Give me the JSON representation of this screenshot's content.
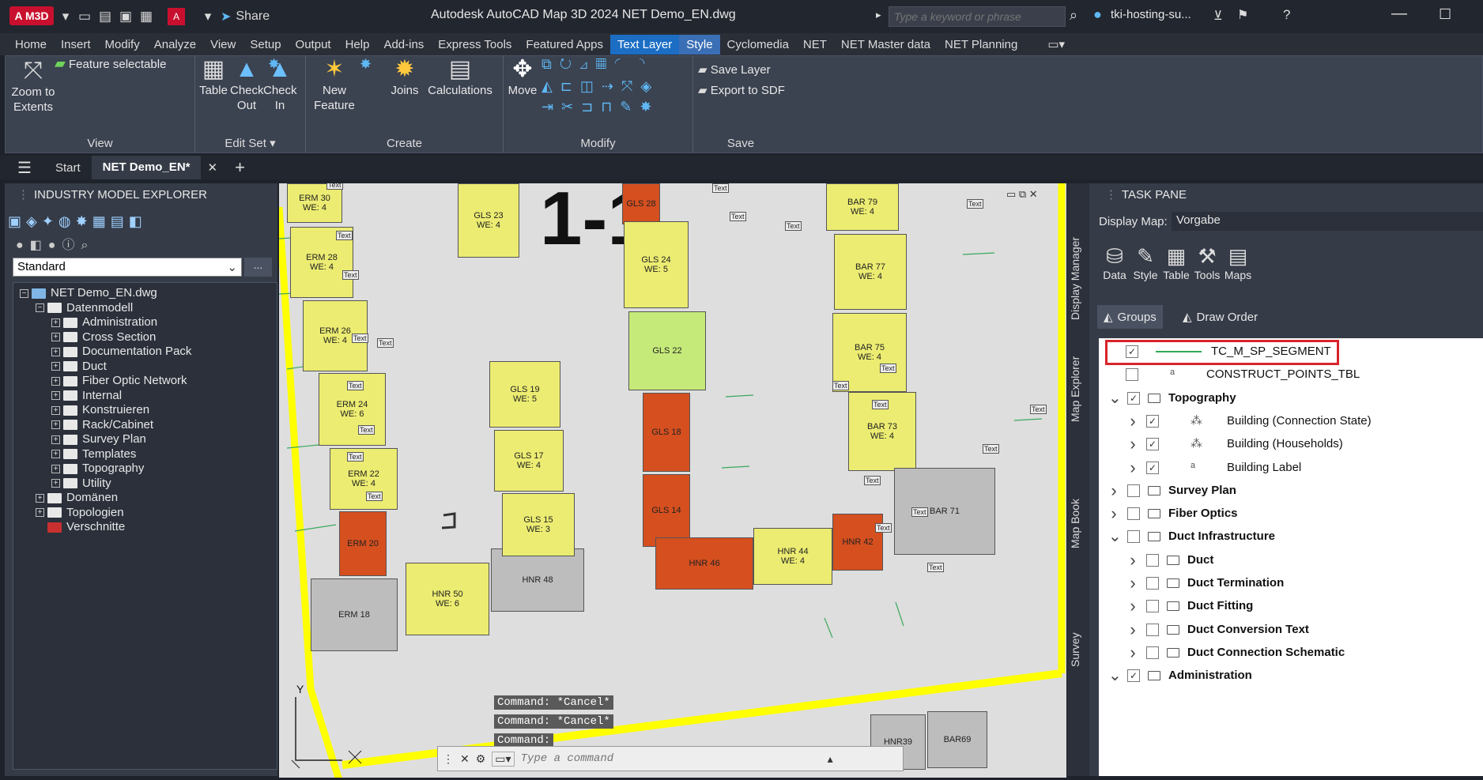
{
  "titlebar": {
    "badge": "A M3D",
    "share": "Share",
    "title": "Autodesk AutoCAD Map 3D 2024    NET Demo_EN.dwg",
    "search_placeholder": "Type a keyword or phrase",
    "user": "tki-hosting-su..."
  },
  "menu": [
    "Home",
    "Insert",
    "Modify",
    "Analyze",
    "View",
    "Setup",
    "Output",
    "Help",
    "Add-ins",
    "Express Tools",
    "Featured Apps",
    "Text Layer",
    "Style",
    "Cyclomedia",
    "NET",
    "NET Master data",
    "NET Planning"
  ],
  "ribbon": {
    "zoom_extents": "Zoom to Extents",
    "feature_selectable": "Feature selectable",
    "view_label": "View",
    "table": "Table",
    "check_out": "Check Out",
    "check_in": "Check In",
    "edit_set_label": "Edit Set",
    "new_feature": "New Feature",
    "joins": "Joins",
    "calculations": "Calculations",
    "create_label": "Create",
    "move": "Move",
    "modify_label": "Modify",
    "save_layer": "Save Layer",
    "export_sdf": "Export to SDF",
    "save_label": "Save"
  },
  "tabs": {
    "start": "Start",
    "doc": "NET Demo_EN*",
    "add": "+"
  },
  "left": {
    "header": "INDUSTRY MODEL EXPLORER",
    "combo_value": "Standard",
    "combo_more": "...",
    "tree": [
      {
        "label": "NET Demo_EN.dwg",
        "level": 0,
        "pm": "−"
      },
      {
        "label": "Datenmodell",
        "level": 1,
        "pm": "−"
      },
      {
        "label": "Administration",
        "level": 2,
        "pm": "+"
      },
      {
        "label": "Cross Section",
        "level": 2,
        "pm": "+"
      },
      {
        "label": "Documentation Pack",
        "level": 2,
        "pm": "+"
      },
      {
        "label": "Duct",
        "level": 2,
        "pm": "+"
      },
      {
        "label": "Fiber Optic Network",
        "level": 2,
        "pm": "+"
      },
      {
        "label": "Internal",
        "level": 2,
        "pm": "+"
      },
      {
        "label": "Konstruieren",
        "level": 2,
        "pm": "+"
      },
      {
        "label": "Rack/Cabinet",
        "level": 2,
        "pm": "+"
      },
      {
        "label": "Survey Plan",
        "level": 2,
        "pm": "+"
      },
      {
        "label": "Templates",
        "level": 2,
        "pm": "+"
      },
      {
        "label": "Topography",
        "level": 2,
        "pm": "+"
      },
      {
        "label": "Utility",
        "level": 2,
        "pm": "+"
      },
      {
        "label": "Domänen",
        "level": 1,
        "pm": "+"
      },
      {
        "label": "Topologien",
        "level": 1,
        "pm": "+"
      },
      {
        "label": "Verschnitte",
        "level": 1,
        "pm": ""
      }
    ]
  },
  "map": {
    "big_label": "1-1",
    "buildings": [
      {
        "name": "ERM 30",
        "sub": "WE: 4",
        "cls": "yel"
      },
      {
        "name": "ERM 28",
        "sub": "WE: 4",
        "cls": "yel"
      },
      {
        "name": "ERM 26",
        "sub": "WE: 4",
        "cls": "yel"
      },
      {
        "name": "ERM 24",
        "sub": "WE: 6",
        "cls": "yel"
      },
      {
        "name": "ERM 22",
        "sub": "WE: 4",
        "cls": "yel"
      },
      {
        "name": "ERM 20",
        "sub": "",
        "cls": "red"
      },
      {
        "name": "ERM 18",
        "sub": "",
        "cls": "gry"
      },
      {
        "name": "HNR 50",
        "sub": "WE: 6",
        "cls": "yel"
      },
      {
        "name": "HNR 48",
        "sub": "",
        "cls": "gry"
      },
      {
        "name": "GLS 23",
        "sub": "WE: 4",
        "cls": "yel"
      },
      {
        "name": "GLS 19",
        "sub": "WE: 5",
        "cls": "yel"
      },
      {
        "name": "GLS 17",
        "sub": "WE: 4",
        "cls": "yel"
      },
      {
        "name": "GLS 15",
        "sub": "WE: 3",
        "cls": "yel"
      },
      {
        "name": "GLS 28",
        "sub": "",
        "cls": "red"
      },
      {
        "name": "GLS 24",
        "sub": "WE: 5",
        "cls": "yel"
      },
      {
        "name": "GLS 22",
        "sub": "",
        "cls": "grn"
      },
      {
        "name": "GLS 18",
        "sub": "",
        "cls": "red"
      },
      {
        "name": "GLS 14",
        "sub": "",
        "cls": "red"
      },
      {
        "name": "HNR 46",
        "sub": "",
        "cls": "red"
      },
      {
        "name": "HNR 44",
        "sub": "WE: 4",
        "cls": "yel"
      },
      {
        "name": "HNR 42",
        "sub": "",
        "cls": "red"
      },
      {
        "name": "BAR 79",
        "sub": "WE: 4",
        "cls": "yel"
      },
      {
        "name": "BAR 77",
        "sub": "WE: 4",
        "cls": "yel"
      },
      {
        "name": "BAR 75",
        "sub": "WE: 4",
        "cls": "yel"
      },
      {
        "name": "BAR 73",
        "sub": "WE: 4",
        "cls": "yel"
      },
      {
        "name": "BAR 71",
        "sub": "",
        "cls": "gry"
      },
      {
        "name": "HNR39",
        "sub": "",
        "cls": "gry"
      },
      {
        "name": "BAR69",
        "sub": "",
        "cls": "gry"
      }
    ],
    "text_tag": "Text",
    "commands": [
      "Command: *Cancel*",
      "Command: *Cancel*",
      "Command:"
    ],
    "cmd_placeholder": "Type a command",
    "axis_y": "Y"
  },
  "vtabs": [
    "Display Manager",
    "Map Explorer",
    "Map Book",
    "Survey"
  ],
  "taskpane": {
    "header": "TASK PANE",
    "display_map_label": "Display Map:",
    "display_map_value": "Vorgabe",
    "buttons": [
      "Data",
      "Style",
      "Table",
      "Tools",
      "Maps"
    ],
    "groups": "Groups",
    "draw_order": "Draw Order",
    "layers": [
      {
        "label": "TC_M_SP_SEGMENT",
        "indent": 0,
        "checked": true,
        "chev": "",
        "kind": "line",
        "bold": false
      },
      {
        "label": "CONSTRUCT_POINTS_TBL",
        "indent": 0,
        "checked": false,
        "chev": "",
        "kind": "text",
        "bold": false
      },
      {
        "label": "Topography",
        "indent": 0,
        "checked": true,
        "chev": "open",
        "kind": "folder",
        "bold": true
      },
      {
        "label": "Building (Connection State)",
        "indent": 1,
        "checked": true,
        "chev": "closed",
        "kind": "theme",
        "bold": false
      },
      {
        "label": "Building (Households)",
        "indent": 1,
        "checked": true,
        "chev": "closed",
        "kind": "theme",
        "bold": false
      },
      {
        "label": "Building Label",
        "indent": 1,
        "checked": true,
        "chev": "closed",
        "kind": "text",
        "bold": false
      },
      {
        "label": "Survey Plan",
        "indent": 0,
        "checked": false,
        "chev": "closed",
        "kind": "folder",
        "bold": true
      },
      {
        "label": "Fiber Optics",
        "indent": 0,
        "checked": false,
        "chev": "closed",
        "kind": "folder",
        "bold": true
      },
      {
        "label": "Duct Infrastructure",
        "indent": 0,
        "checked": false,
        "chev": "open",
        "kind": "folder",
        "bold": true
      },
      {
        "label": "Duct",
        "indent": 1,
        "checked": false,
        "chev": "closed",
        "kind": "folder",
        "bold": true
      },
      {
        "label": "Duct Termination",
        "indent": 1,
        "checked": false,
        "chev": "closed",
        "kind": "folder",
        "bold": true
      },
      {
        "label": "Duct Fitting",
        "indent": 1,
        "checked": false,
        "chev": "closed",
        "kind": "folder",
        "bold": true
      },
      {
        "label": "Duct Conversion Text",
        "indent": 1,
        "checked": false,
        "chev": "closed",
        "kind": "folder",
        "bold": true
      },
      {
        "label": "Duct Connection Schematic",
        "indent": 1,
        "checked": false,
        "chev": "closed",
        "kind": "folder",
        "bold": true
      },
      {
        "label": "Administration",
        "indent": 0,
        "checked": true,
        "chev": "open",
        "kind": "folder",
        "bold": true
      }
    ]
  },
  "colors": {
    "accent": "#1c6ec4",
    "highlight": "#d9232b",
    "building_yellow": "#ecec72",
    "building_red": "#d54f1f",
    "building_green": "#c6ea7a",
    "road_yellow": "#ffff00"
  }
}
